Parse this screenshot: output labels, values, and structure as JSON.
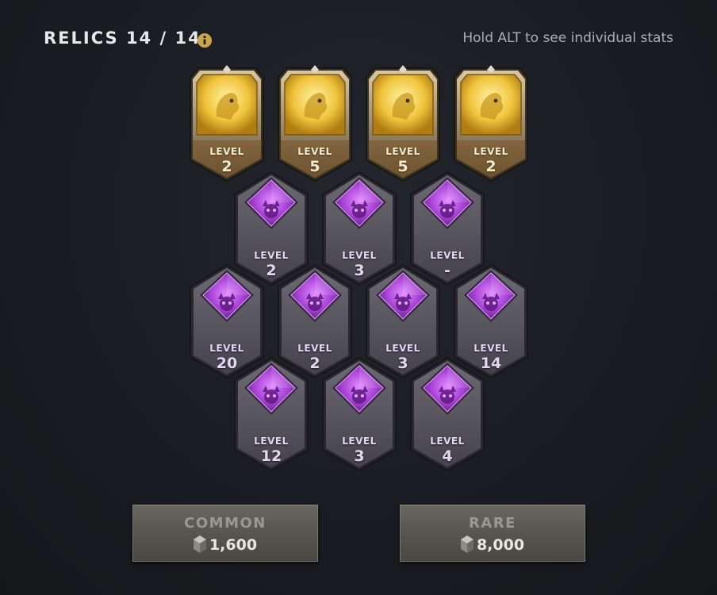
{
  "header": {
    "title": "RELICS 14 / 14",
    "hint": "Hold ALT to see individual stats"
  },
  "level_label": "LEVEL",
  "colors": {
    "gold": "#f0c84a",
    "purple": "#b84de0",
    "stone": "#55525a"
  },
  "relics": {
    "row1": [
      {
        "rarity": "rare",
        "icon": "wolf-head-icon",
        "level": "2"
      },
      {
        "rarity": "rare",
        "icon": "wolf-head-icon",
        "level": "5"
      },
      {
        "rarity": "rare",
        "icon": "hand-grab-icon",
        "level": "5"
      },
      {
        "rarity": "rare",
        "icon": "cage-trap-icon",
        "level": "2"
      }
    ],
    "row2": [
      {
        "rarity": "common",
        "icon": "horned-skull-icon",
        "level": "2"
      },
      {
        "rarity": "common",
        "icon": "sword-icon",
        "level": "3"
      },
      {
        "rarity": "common",
        "icon": "eye-target-icon",
        "level": "-"
      }
    ],
    "row3": [
      {
        "rarity": "common",
        "icon": "horned-skull-icon",
        "level": "20"
      },
      {
        "rarity": "common",
        "icon": "wings-icon",
        "level": "2"
      },
      {
        "rarity": "common",
        "icon": "skull-icon",
        "level": "3"
      },
      {
        "rarity": "common",
        "icon": "crossed-weapons-icon",
        "level": "14"
      }
    ],
    "row4": [
      {
        "rarity": "common",
        "icon": "flame-icon",
        "level": "12"
      },
      {
        "rarity": "common",
        "icon": "fist-icon",
        "level": "3"
      },
      {
        "rarity": "common",
        "icon": "skull-pile-icon",
        "level": "4"
      }
    ]
  },
  "buttons": {
    "common": {
      "label": "COMMON",
      "price": "1,600",
      "icon": "shard-currency-icon"
    },
    "rare": {
      "label": "RARE",
      "price": "8,000",
      "icon": "shard-currency-icon"
    }
  }
}
